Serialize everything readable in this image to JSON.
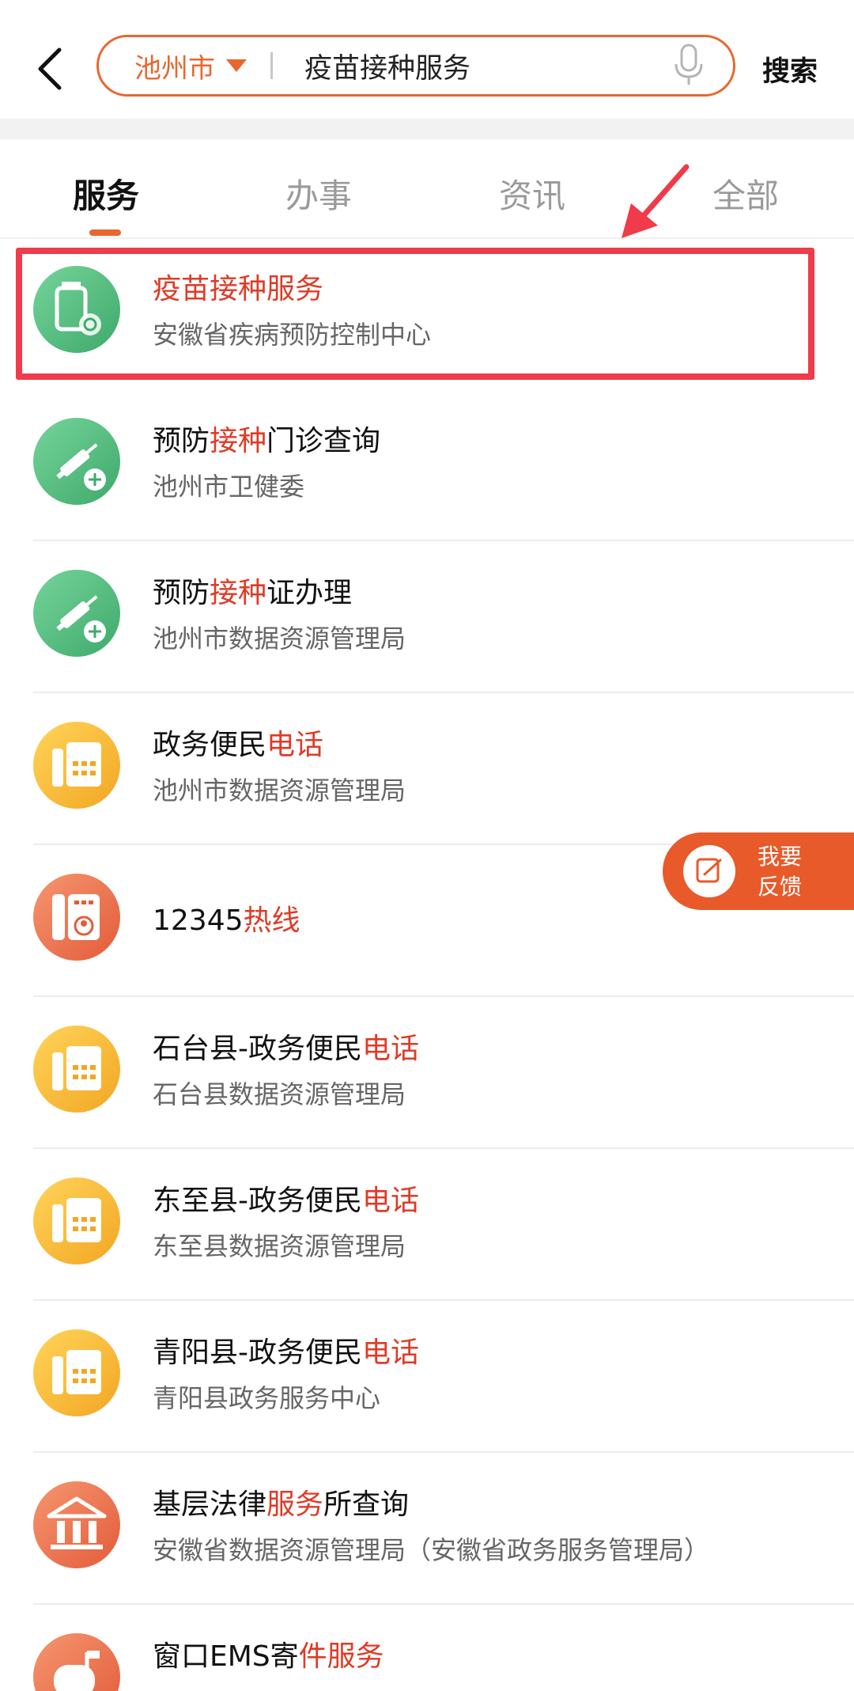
{
  "search": {
    "city": "池州市",
    "query": "疫苗接种服务",
    "search_label": "搜索"
  },
  "tabs": [
    {
      "label": "服务"
    },
    {
      "label": "办事"
    },
    {
      "label": "资讯"
    },
    {
      "label": "全部"
    }
  ],
  "results": [
    {
      "title_pre": "",
      "title_hl": "疫苗接种服务",
      "title_post": "",
      "subtitle": "安徽省疾病预防控制中心",
      "icon": "vaccine-bottle-icon"
    },
    {
      "title_pre": "预防",
      "title_hl": "接种",
      "title_post": "门诊查询",
      "subtitle": "池州市卫健委",
      "icon": "syringe-icon"
    },
    {
      "title_pre": "预防",
      "title_hl": "接种",
      "title_post": "证办理",
      "subtitle": "池州市数据资源管理局",
      "icon": "syringe-icon"
    },
    {
      "title_pre": "政务便民",
      "title_hl": "电话",
      "title_post": "",
      "subtitle": "池州市数据资源管理局",
      "icon": "fax-phone-icon"
    },
    {
      "title_pre": "12345",
      "title_hl": "热线",
      "title_post": "",
      "subtitle": "",
      "icon": "hotline-phone-icon"
    },
    {
      "title_pre": "石台县-政务便民",
      "title_hl": "电话",
      "title_post": "",
      "subtitle": "石台县数据资源管理局",
      "icon": "fax-phone-icon"
    },
    {
      "title_pre": "东至县-政务便民",
      "title_hl": "电话",
      "title_post": "",
      "subtitle": "东至县数据资源管理局",
      "icon": "fax-phone-icon"
    },
    {
      "title_pre": "青阳县-政务便民",
      "title_hl": "电话",
      "title_post": "",
      "subtitle": "青阳县政务服务中心",
      "icon": "fax-phone-icon"
    },
    {
      "title_pre": "基层法律",
      "title_hl": "服务",
      "title_post": "所查询",
      "subtitle": "安徽省数据资源管理局（安徽省政务服务管理局）",
      "icon": "courthouse-icon"
    },
    {
      "title_pre": "窗口EMS寄",
      "title_hl": "件服务",
      "title_post": "",
      "subtitle": "",
      "icon": "mailbox-icon"
    }
  ],
  "feedback": {
    "line1": "我要",
    "line2": "反馈"
  },
  "colors": {
    "accent": "#e8672f",
    "highlight_text": "#e03a26",
    "annotation_red": "#ef3b4a"
  }
}
